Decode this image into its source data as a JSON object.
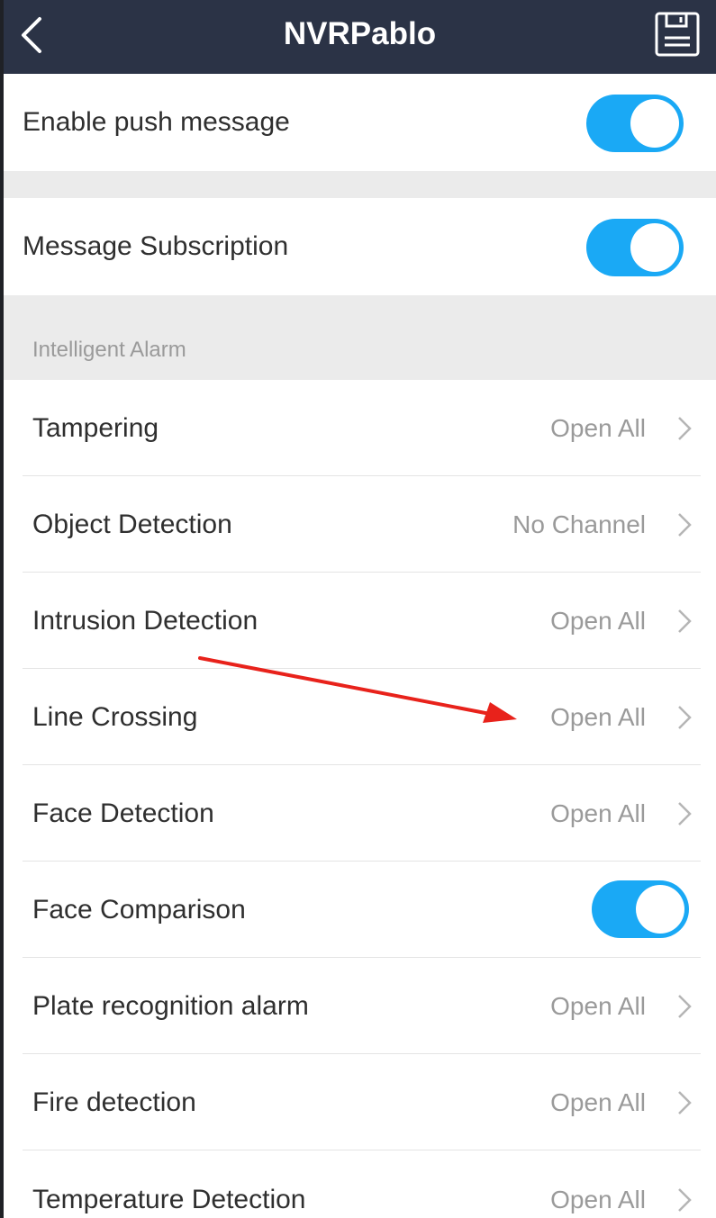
{
  "header": {
    "title": "NVRPablo",
    "back_icon": "chevron-left-icon",
    "save_icon": "floppy-disk-icon"
  },
  "push": {
    "label": "Enable push message",
    "enabled": true
  },
  "subscription": {
    "label": "Message Subscription",
    "enabled": true
  },
  "section": {
    "title": "Intelligent Alarm"
  },
  "items": [
    {
      "label": "Tampering",
      "value": "Open All"
    },
    {
      "label": "Object Detection",
      "value": "No Channel"
    },
    {
      "label": "Intrusion Detection",
      "value": "Open All"
    },
    {
      "label": "Line Crossing",
      "value": "Open All"
    },
    {
      "label": "Face Detection",
      "value": "Open All"
    },
    {
      "label": "Face Comparison",
      "toggle": true
    },
    {
      "label": "Plate recognition alarm",
      "value": "Open All"
    },
    {
      "label": "Fire detection",
      "value": "Open All"
    },
    {
      "label": "Temperature Detection",
      "value": "Open All"
    }
  ],
  "colors": {
    "navbar": "#2b3346",
    "toggle_on": "#1aa9f5",
    "annotation_arrow": "#e8221b"
  }
}
